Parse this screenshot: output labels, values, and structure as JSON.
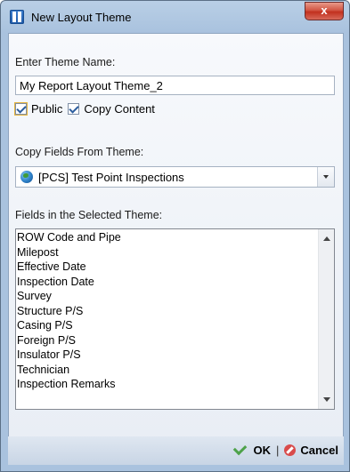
{
  "window": {
    "title": "New Layout Theme",
    "close_label": "x"
  },
  "theme_name": {
    "label": "Enter Theme Name:",
    "value": "My Report Layout Theme_2"
  },
  "options": {
    "public_label": "Public",
    "public_checked": true,
    "copy_content_label": "Copy Content",
    "copy_content_checked": true
  },
  "copy_from": {
    "label": "Copy Fields From Theme:",
    "selected": "[PCS] Test Point Inspections",
    "icon": "globe-icon"
  },
  "fields": {
    "label": "Fields in the Selected Theme:",
    "items": [
      "ROW Code and Pipe",
      "Milepost",
      "Effective Date",
      "Inspection Date",
      "Survey",
      "Structure P/S",
      "Casing P/S",
      "Foreign P/S",
      "Insulator P/S",
      "Technician",
      "Inspection Remarks"
    ]
  },
  "footer": {
    "ok_label": "OK",
    "separator": "|",
    "cancel_label": "Cancel"
  }
}
